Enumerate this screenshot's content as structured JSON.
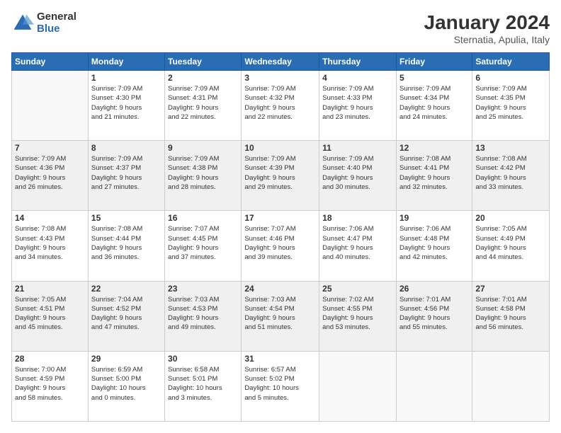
{
  "logo": {
    "general": "General",
    "blue": "Blue"
  },
  "title": "January 2024",
  "location": "Sternatia, Apulia, Italy",
  "days_header": [
    "Sunday",
    "Monday",
    "Tuesday",
    "Wednesday",
    "Thursday",
    "Friday",
    "Saturday"
  ],
  "weeks": [
    [
      {
        "day": "",
        "info": ""
      },
      {
        "day": "1",
        "info": "Sunrise: 7:09 AM\nSunset: 4:30 PM\nDaylight: 9 hours\nand 21 minutes."
      },
      {
        "day": "2",
        "info": "Sunrise: 7:09 AM\nSunset: 4:31 PM\nDaylight: 9 hours\nand 22 minutes."
      },
      {
        "day": "3",
        "info": "Sunrise: 7:09 AM\nSunset: 4:32 PM\nDaylight: 9 hours\nand 22 minutes."
      },
      {
        "day": "4",
        "info": "Sunrise: 7:09 AM\nSunset: 4:33 PM\nDaylight: 9 hours\nand 23 minutes."
      },
      {
        "day": "5",
        "info": "Sunrise: 7:09 AM\nSunset: 4:34 PM\nDaylight: 9 hours\nand 24 minutes."
      },
      {
        "day": "6",
        "info": "Sunrise: 7:09 AM\nSunset: 4:35 PM\nDaylight: 9 hours\nand 25 minutes."
      }
    ],
    [
      {
        "day": "7",
        "info": "Sunrise: 7:09 AM\nSunset: 4:36 PM\nDaylight: 9 hours\nand 26 minutes."
      },
      {
        "day": "8",
        "info": "Sunrise: 7:09 AM\nSunset: 4:37 PM\nDaylight: 9 hours\nand 27 minutes."
      },
      {
        "day": "9",
        "info": "Sunrise: 7:09 AM\nSunset: 4:38 PM\nDaylight: 9 hours\nand 28 minutes."
      },
      {
        "day": "10",
        "info": "Sunrise: 7:09 AM\nSunset: 4:39 PM\nDaylight: 9 hours\nand 29 minutes."
      },
      {
        "day": "11",
        "info": "Sunrise: 7:09 AM\nSunset: 4:40 PM\nDaylight: 9 hours\nand 30 minutes."
      },
      {
        "day": "12",
        "info": "Sunrise: 7:08 AM\nSunset: 4:41 PM\nDaylight: 9 hours\nand 32 minutes."
      },
      {
        "day": "13",
        "info": "Sunrise: 7:08 AM\nSunset: 4:42 PM\nDaylight: 9 hours\nand 33 minutes."
      }
    ],
    [
      {
        "day": "14",
        "info": "Sunrise: 7:08 AM\nSunset: 4:43 PM\nDaylight: 9 hours\nand 34 minutes."
      },
      {
        "day": "15",
        "info": "Sunrise: 7:08 AM\nSunset: 4:44 PM\nDaylight: 9 hours\nand 36 minutes."
      },
      {
        "day": "16",
        "info": "Sunrise: 7:07 AM\nSunset: 4:45 PM\nDaylight: 9 hours\nand 37 minutes."
      },
      {
        "day": "17",
        "info": "Sunrise: 7:07 AM\nSunset: 4:46 PM\nDaylight: 9 hours\nand 39 minutes."
      },
      {
        "day": "18",
        "info": "Sunrise: 7:06 AM\nSunset: 4:47 PM\nDaylight: 9 hours\nand 40 minutes."
      },
      {
        "day": "19",
        "info": "Sunrise: 7:06 AM\nSunset: 4:48 PM\nDaylight: 9 hours\nand 42 minutes."
      },
      {
        "day": "20",
        "info": "Sunrise: 7:05 AM\nSunset: 4:49 PM\nDaylight: 9 hours\nand 44 minutes."
      }
    ],
    [
      {
        "day": "21",
        "info": "Sunrise: 7:05 AM\nSunset: 4:51 PM\nDaylight: 9 hours\nand 45 minutes."
      },
      {
        "day": "22",
        "info": "Sunrise: 7:04 AM\nSunset: 4:52 PM\nDaylight: 9 hours\nand 47 minutes."
      },
      {
        "day": "23",
        "info": "Sunrise: 7:03 AM\nSunset: 4:53 PM\nDaylight: 9 hours\nand 49 minutes."
      },
      {
        "day": "24",
        "info": "Sunrise: 7:03 AM\nSunset: 4:54 PM\nDaylight: 9 hours\nand 51 minutes."
      },
      {
        "day": "25",
        "info": "Sunrise: 7:02 AM\nSunset: 4:55 PM\nDaylight: 9 hours\nand 53 minutes."
      },
      {
        "day": "26",
        "info": "Sunrise: 7:01 AM\nSunset: 4:56 PM\nDaylight: 9 hours\nand 55 minutes."
      },
      {
        "day": "27",
        "info": "Sunrise: 7:01 AM\nSunset: 4:58 PM\nDaylight: 9 hours\nand 56 minutes."
      }
    ],
    [
      {
        "day": "28",
        "info": "Sunrise: 7:00 AM\nSunset: 4:59 PM\nDaylight: 9 hours\nand 58 minutes."
      },
      {
        "day": "29",
        "info": "Sunrise: 6:59 AM\nSunset: 5:00 PM\nDaylight: 10 hours\nand 0 minutes."
      },
      {
        "day": "30",
        "info": "Sunrise: 6:58 AM\nSunset: 5:01 PM\nDaylight: 10 hours\nand 3 minutes."
      },
      {
        "day": "31",
        "info": "Sunrise: 6:57 AM\nSunset: 5:02 PM\nDaylight: 10 hours\nand 5 minutes."
      },
      {
        "day": "",
        "info": ""
      },
      {
        "day": "",
        "info": ""
      },
      {
        "day": "",
        "info": ""
      }
    ]
  ]
}
